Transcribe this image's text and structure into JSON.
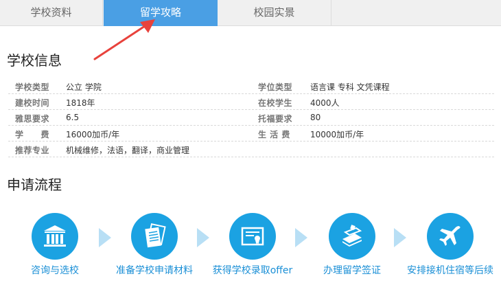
{
  "tabs": [
    {
      "label": "学校资料",
      "active": false
    },
    {
      "label": "留学攻略",
      "active": true
    },
    {
      "label": "校园实景",
      "active": false
    }
  ],
  "sections": {
    "school_info_title": "学校信息",
    "process_title": "申请流程"
  },
  "school_info": {
    "rows": [
      {
        "l1": "学校类型",
        "v1": "公立 学院",
        "l2": "学位类型",
        "v2": "语言课 专科 文凭课程"
      },
      {
        "l1": "建校时间",
        "v1": "1818年",
        "l2": "在校学生",
        "v2": "4000人"
      },
      {
        "l1": "雅思要求",
        "v1": "6.5",
        "l2": "托福要求",
        "v2": "80"
      },
      {
        "l1": "学　　费",
        "v1": "16000加币/年",
        "l2": "生 活 费",
        "v2": "10000加币/年"
      },
      {
        "l1": "推荐专业",
        "v1": "机械维修，法语，翻译，商业管理",
        "l2": "",
        "v2": ""
      }
    ]
  },
  "process": {
    "steps": [
      {
        "label": "咨询与选校",
        "icon": "school-building-icon"
      },
      {
        "label": "准备学校申请材料",
        "icon": "documents-icon"
      },
      {
        "label": "获得学校录取offer",
        "icon": "certificate-icon"
      },
      {
        "label": "办理留学签证",
        "icon": "passport-books-icon"
      },
      {
        "label": "安排接机住宿等后续",
        "icon": "airplane-icon"
      }
    ]
  },
  "colors": {
    "tab_active": "#4a9fe4",
    "step_circle": "#1ba2e2",
    "step_label": "#1a8fd6",
    "chevron": "#b8dff5",
    "arrow": "#e8423c"
  }
}
